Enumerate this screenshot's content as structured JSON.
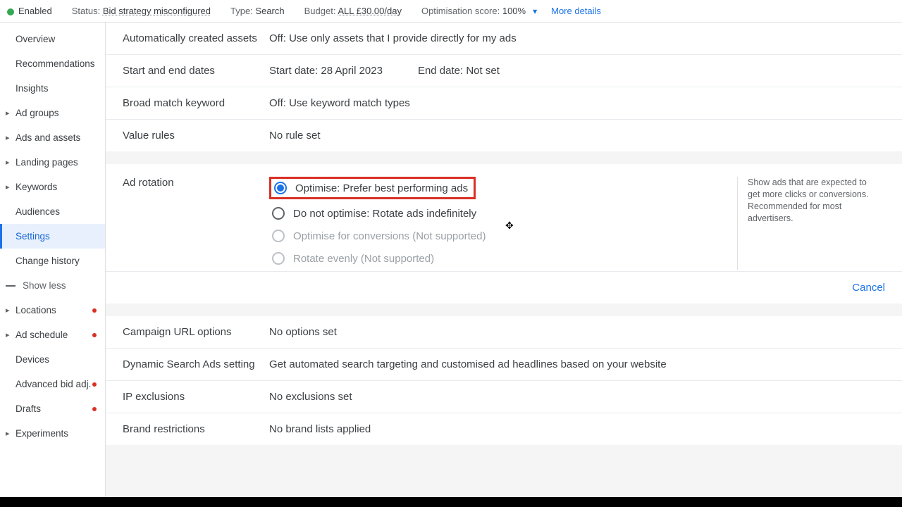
{
  "topbar": {
    "enabled": "Enabled",
    "status_label": "Status:",
    "status_value": "Bid strategy misconfigured",
    "type_label": "Type:",
    "type_value": "Search",
    "budget_label": "Budget:",
    "budget_value": "ALL £30.00/day",
    "opt_label": "Optimisation score:",
    "opt_value": "100%",
    "more": "More details"
  },
  "sidebar": {
    "items": [
      {
        "label": "Overview",
        "caret": false,
        "dot": false
      },
      {
        "label": "Recommendations",
        "caret": false,
        "dot": false
      },
      {
        "label": "Insights",
        "caret": false,
        "dot": false
      },
      {
        "label": "Ad groups",
        "caret": true,
        "dot": false
      },
      {
        "label": "Ads and assets",
        "caret": true,
        "dot": false
      },
      {
        "label": "Landing pages",
        "caret": true,
        "dot": false
      },
      {
        "label": "Keywords",
        "caret": true,
        "dot": false
      },
      {
        "label": "Audiences",
        "caret": false,
        "dot": false
      },
      {
        "label": "Settings",
        "caret": false,
        "dot": false,
        "selected": true
      },
      {
        "label": "Change history",
        "caret": false,
        "dot": false
      }
    ],
    "showless": "Show less",
    "items2": [
      {
        "label": "Locations",
        "caret": true,
        "dot": true
      },
      {
        "label": "Ad schedule",
        "caret": true,
        "dot": true
      },
      {
        "label": "Devices",
        "caret": false,
        "dot": false
      },
      {
        "label": "Advanced bid adj.",
        "caret": false,
        "dot": true
      },
      {
        "label": "Drafts",
        "caret": false,
        "dot": true
      },
      {
        "label": "Experiments",
        "caret": true,
        "dot": false
      }
    ]
  },
  "settings_rows_top": [
    {
      "label": "Automatically created assets",
      "value": "Off: Use only assets that I provide directly for my ads"
    },
    {
      "label": "Start and end dates",
      "value_a": "Start date: 28 April 2023",
      "value_b": "End date: Not set"
    },
    {
      "label": "Broad match keyword",
      "value": "Off: Use keyword match types"
    },
    {
      "label": "Value rules",
      "value": "No rule set"
    }
  ],
  "ad_rotation": {
    "label": "Ad rotation",
    "options": [
      {
        "text": "Optimise: Prefer best performing ads",
        "selected": true,
        "disabled": false,
        "highlight": true
      },
      {
        "text": "Do not optimise: Rotate ads indefinitely",
        "selected": false,
        "disabled": false
      },
      {
        "text": "Optimise for conversions (Not supported)",
        "selected": false,
        "disabled": true
      },
      {
        "text": "Rotate evenly (Not supported)",
        "selected": false,
        "disabled": true
      }
    ],
    "help": "Show ads that are expected to get more clicks or conversions. Recommended for most advertisers.",
    "cancel": "Cancel"
  },
  "settings_rows_bottom": [
    {
      "label": "Campaign URL options",
      "value": "No options set"
    },
    {
      "label": "Dynamic Search Ads setting",
      "value": "Get automated search targeting and customised ad headlines based on your website"
    },
    {
      "label": "IP exclusions",
      "value": "No exclusions set"
    },
    {
      "label": "Brand restrictions",
      "value": "No brand lists applied"
    }
  ]
}
